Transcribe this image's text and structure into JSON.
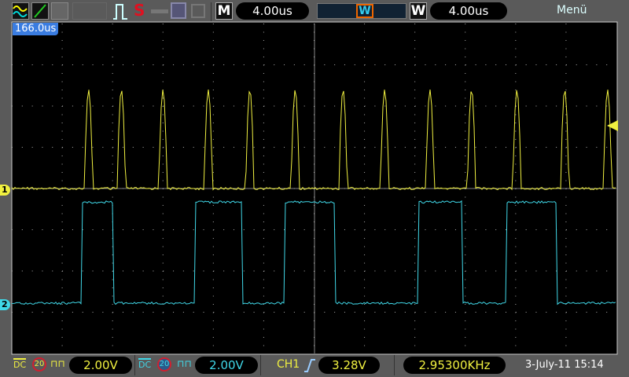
{
  "toolbar": {
    "icons": [
      "channels-icon",
      "math-icon",
      "ref-icon",
      "pulse-icon",
      "stop-icon",
      "key-icon",
      "save-icon",
      "print-icon"
    ],
    "stop_label": "S",
    "main_label": "M",
    "main_timebase": "4.00us",
    "window_label": "W",
    "window_marker": "W",
    "window_timebase": "4.00us",
    "menu_label": "Menü"
  },
  "trigger_position": "166.0us",
  "ch1": {
    "marker": "1",
    "coupling": "DC",
    "bw_limit": "20",
    "volts_div": "2.00V",
    "color": "#f0f040"
  },
  "ch2": {
    "marker": "2",
    "coupling": "DC",
    "bw_limit": "20",
    "volts_div": "2.00V",
    "color": "#40d8e8"
  },
  "trigger": {
    "source": "CH1",
    "slope": "rising",
    "level": "3.28V"
  },
  "frequency": "2.95300KHz",
  "datetime": "3-July-11 15:14",
  "waveforms": {
    "time_per_div_us": 4,
    "volts_per_div": 2,
    "ch1_pulse_peaks_us": [
      6.1,
      8.7,
      12.0,
      15.6,
      18.9,
      22.5,
      26.3,
      29.6,
      33.2,
      36.5,
      40.1,
      43.9,
      47.3
    ],
    "ch1_pulse_high_v": 4.8,
    "ch2_rises_us": [
      5.6,
      14.6,
      21.6,
      32.3,
      39.2
    ],
    "ch2_falls_us": [
      8.0,
      18.3,
      25.7,
      35.8,
      43.3
    ],
    "ch2_high_v": 4.9
  }
}
